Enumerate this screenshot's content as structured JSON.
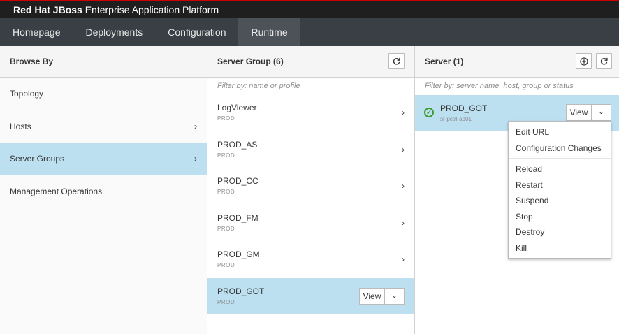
{
  "brand": {
    "bold": "Red Hat JBoss",
    "rest": " Enterprise Application Platform"
  },
  "nav": {
    "tabs": [
      {
        "label": "Homepage"
      },
      {
        "label": "Deployments"
      },
      {
        "label": "Configuration"
      },
      {
        "label": "Runtime",
        "active": true
      }
    ]
  },
  "browse": {
    "title": "Browse By",
    "items": [
      {
        "label": "Topology"
      },
      {
        "label": "Hosts",
        "chevron": "›"
      },
      {
        "label": "Server Groups",
        "chevron": "›",
        "selected": true
      },
      {
        "label": "Management Operations"
      }
    ]
  },
  "groups": {
    "title": "Server Group (6)",
    "refresh_icon": "refresh-icon",
    "filter_placeholder": "Filter by: name or profile",
    "items": [
      {
        "name": "LogViewer",
        "profile": "PROD"
      },
      {
        "name": "PROD_AS",
        "profile": "PROD"
      },
      {
        "name": "PROD_CC",
        "profile": "PROD"
      },
      {
        "name": "PROD_FM",
        "profile": "PROD"
      },
      {
        "name": "PROD_GM",
        "profile": "PROD"
      },
      {
        "name": "PROD_GOT",
        "profile": "PROD",
        "selected": true
      }
    ],
    "view_label": "View",
    "chevron": "›",
    "caret": "⌄"
  },
  "servers": {
    "title": "Server (1)",
    "filter_placeholder": "Filter by: server name, host, group or status",
    "items": [
      {
        "name": "PROD_GOT",
        "host": "sr-pctrl-ap01",
        "status": "ok"
      }
    ],
    "view_label": "View",
    "caret": "⌄",
    "add_icon": "add-icon",
    "refresh_icon": "refresh-icon"
  },
  "menu": {
    "group1": [
      {
        "label": "Edit URL"
      },
      {
        "label": "Configuration Changes"
      }
    ],
    "group2": [
      {
        "label": "Reload"
      },
      {
        "label": "Restart"
      },
      {
        "label": "Suspend"
      },
      {
        "label": "Stop"
      },
      {
        "label": "Destroy"
      },
      {
        "label": "Kill"
      }
    ]
  },
  "colors": {
    "selected": "#bde0f1",
    "nav": "#393f44",
    "nav_active": "#4d5258",
    "status_ok": "#3f9c35"
  }
}
